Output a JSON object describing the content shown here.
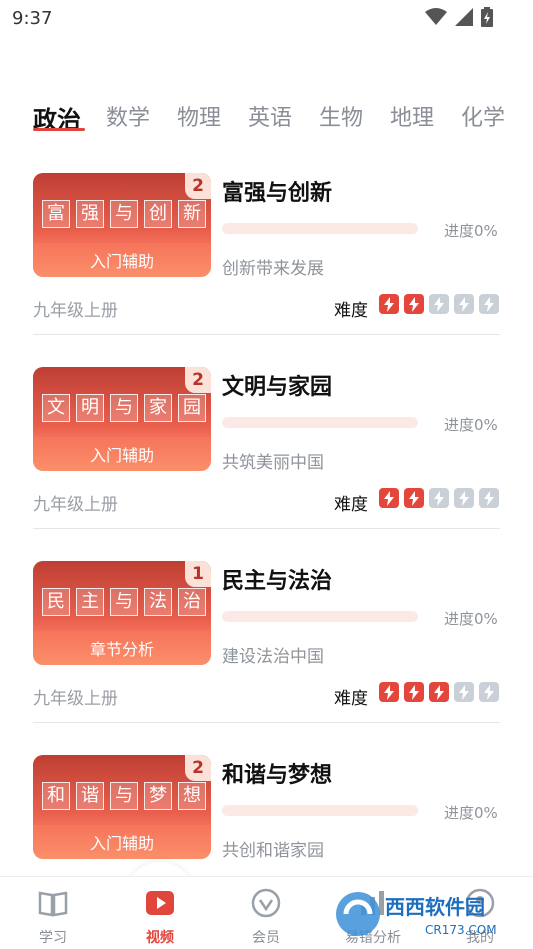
{
  "status": {
    "time": "9:37"
  },
  "tabs": [
    "政治",
    "数学",
    "物理",
    "英语",
    "生物",
    "地理",
    "化学"
  ],
  "active_tab": "政治",
  "progress_prefix": "进度",
  "difficulty_label": "难度",
  "courses": [
    {
      "tiles": [
        "富",
        "强",
        "与",
        "创",
        "新"
      ],
      "badge": "2",
      "label": "入门辅助",
      "title": "富强与创新",
      "progress": "进度0%",
      "progress_value": 0,
      "subtitle": "创新带来发展",
      "grade": "九年级上册",
      "difficulty": 2
    },
    {
      "tiles": [
        "文",
        "明",
        "与",
        "家",
        "园"
      ],
      "badge": "2",
      "label": "入门辅助",
      "title": "文明与家园",
      "progress": "进度0%",
      "progress_value": 0,
      "subtitle": "共筑美丽中国",
      "grade": "九年级上册",
      "difficulty": 2
    },
    {
      "tiles": [
        "民",
        "主",
        "与",
        "法",
        "治"
      ],
      "badge": "1",
      "label": "章节分析",
      "title": "民主与法治",
      "progress": "进度0%",
      "progress_value": 0,
      "subtitle": "建设法治中国",
      "grade": "九年级上册",
      "difficulty": 3
    },
    {
      "tiles": [
        "和",
        "谐",
        "与",
        "梦",
        "想"
      ],
      "badge": "2",
      "label": "入门辅助",
      "title": "和谐与梦想",
      "progress": "进度0%",
      "progress_value": 0,
      "subtitle": "共创和谐家园",
      "grade": "",
      "difficulty": 0
    }
  ],
  "nav": [
    {
      "label": "学习",
      "icon": "book-icon",
      "active": false
    },
    {
      "label": "视频",
      "icon": "play-video-icon",
      "active": true
    },
    {
      "label": "会员",
      "icon": "vip-icon",
      "active": false
    },
    {
      "label": "易错分析",
      "icon": "chart-icon",
      "active": false
    },
    {
      "label": "我的",
      "icon": "profile-icon",
      "active": false
    }
  ],
  "watermark": {
    "brand": "西西软件园",
    "url": "CR173.COM"
  },
  "colors": {
    "accent": "#e0463c",
    "muted": "#8a8f97",
    "bolt_off": "#c9d0d8"
  }
}
